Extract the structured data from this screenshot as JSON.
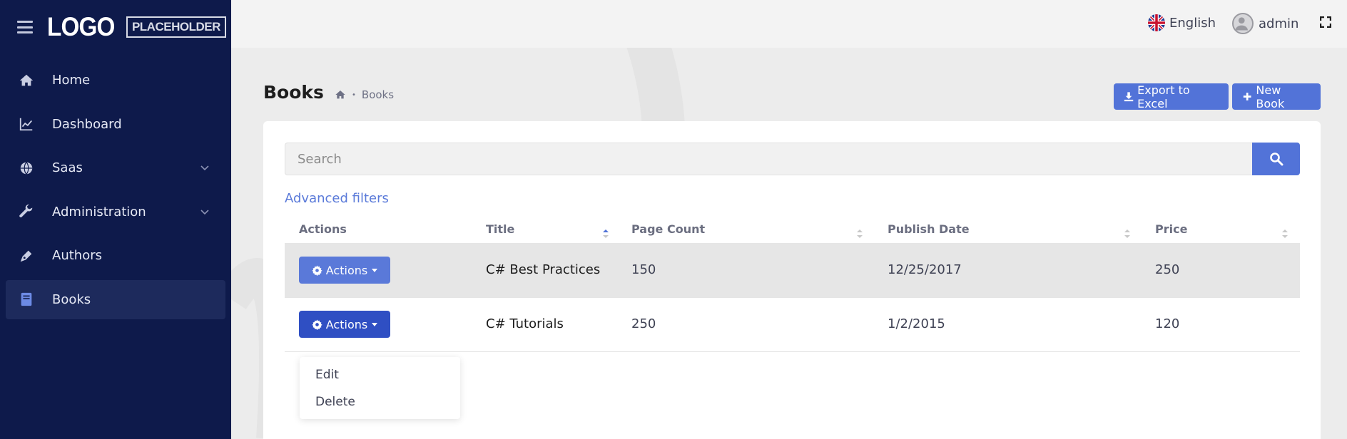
{
  "colors": {
    "sidebar_bg": "#0e1a4b",
    "primary": "#5273d8",
    "active_nav_bg": "#1d2a5c"
  },
  "logo": {
    "main": "LOGO",
    "sub": "PLACEHOLDER"
  },
  "sidebar": {
    "items": [
      {
        "label": "Home",
        "icon": "home-icon"
      },
      {
        "label": "Dashboard",
        "icon": "chart-line-icon"
      },
      {
        "label": "Saas",
        "icon": "globe-icon",
        "expandable": true
      },
      {
        "label": "Administration",
        "icon": "wrench-icon",
        "expandable": true
      },
      {
        "label": "Authors",
        "icon": "pen-icon"
      },
      {
        "label": "Books",
        "icon": "book-icon",
        "active": true
      }
    ]
  },
  "header": {
    "language": "English",
    "user": "admin"
  },
  "page": {
    "title": "Books",
    "breadcrumb": "Books",
    "export_label": "Export to Excel",
    "new_label": "New Book"
  },
  "search": {
    "placeholder": "Search",
    "advanced_filters": "Advanced filters"
  },
  "table": {
    "headers": [
      "Actions",
      "Title",
      "Page Count",
      "Publish Date",
      "Price"
    ],
    "rows": [
      {
        "action": "Actions",
        "title": "C# Best Practices",
        "page_count": "150",
        "publish_date": "12/25/2017",
        "price": "250"
      },
      {
        "action": "Actions",
        "title": "C# Tutorials",
        "page_count": "250",
        "publish_date": "1/2/2015",
        "price": "120"
      }
    ]
  },
  "dropdown": {
    "items": [
      "Edit",
      "Delete"
    ]
  }
}
